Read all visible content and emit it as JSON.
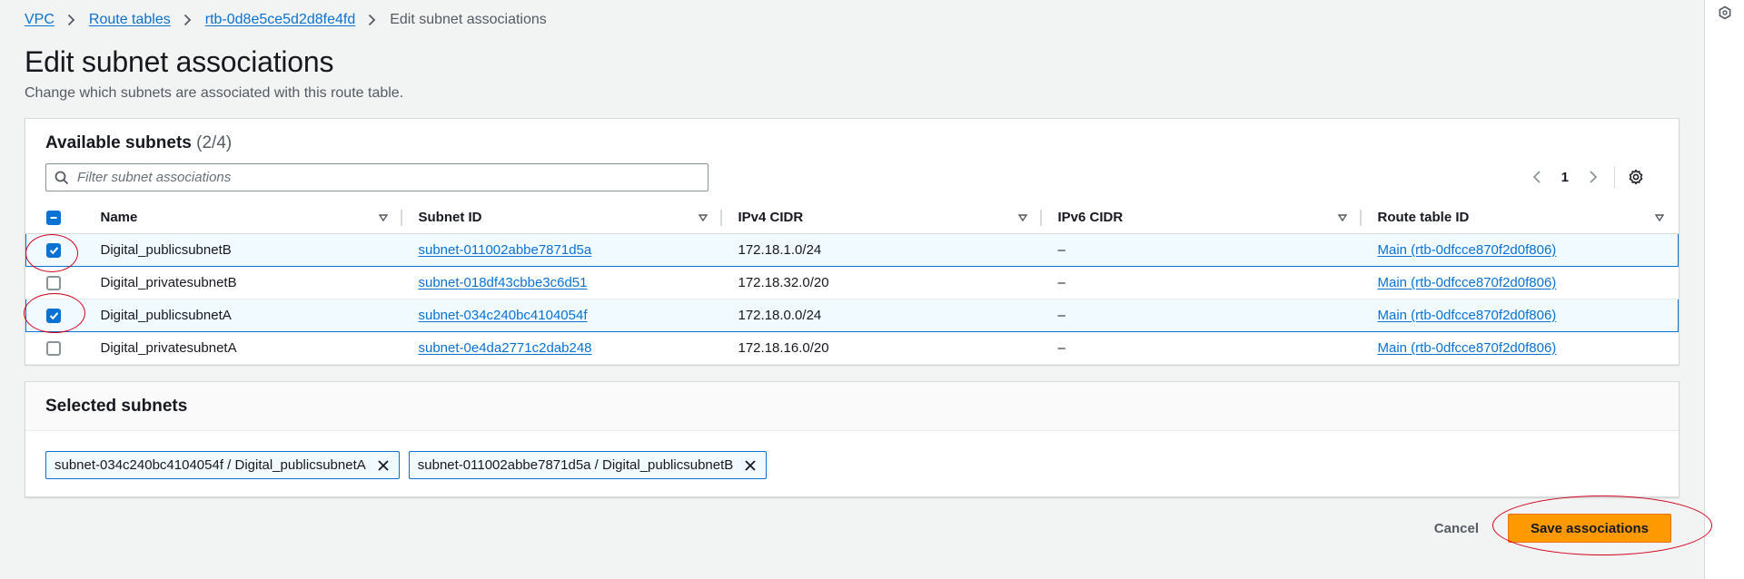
{
  "breadcrumb": {
    "items": [
      "VPC",
      "Route tables",
      "rtb-0d8e5ce5d2d8fe4fd"
    ],
    "current": "Edit subnet associations"
  },
  "page": {
    "title": "Edit subnet associations",
    "description": "Change which subnets are associated with this route table."
  },
  "available": {
    "title": "Available subnets",
    "count": "(2/4)",
    "search_placeholder": "Filter subnet associations",
    "page_number": "1",
    "columns": [
      "Name",
      "Subnet ID",
      "IPv4 CIDR",
      "IPv6 CIDR",
      "Route table ID"
    ],
    "rows": [
      {
        "name": "Digital_publicsubnetB",
        "subnet_id": "subnet-011002abbe7871d5a",
        "ipv4": "172.18.1.0/24",
        "ipv6": "–",
        "route_table": "Main (rtb-0dfcce870f2d0f806)",
        "checked": true
      },
      {
        "name": "Digital_privatesubnetB",
        "subnet_id": "subnet-018df43cbbe3c6d51",
        "ipv4": "172.18.32.0/20",
        "ipv6": "–",
        "route_table": "Main (rtb-0dfcce870f2d0f806)",
        "checked": false
      },
      {
        "name": "Digital_publicsubnetA",
        "subnet_id": "subnet-034c240bc4104054f",
        "ipv4": "172.18.0.0/24",
        "ipv6": "–",
        "route_table": "Main (rtb-0dfcce870f2d0f806)",
        "checked": true
      },
      {
        "name": "Digital_privatesubnetA",
        "subnet_id": "subnet-0e4da2771c2dab248",
        "ipv4": "172.18.16.0/20",
        "ipv6": "–",
        "route_table": "Main (rtb-0dfcce870f2d0f806)",
        "checked": false
      }
    ]
  },
  "selected": {
    "title": "Selected subnets",
    "tokens": [
      "subnet-034c240bc4104054f / Digital_publicsubnetA",
      "subnet-011002abbe7871d5a / Digital_publicsubnetB"
    ]
  },
  "actions": {
    "cancel_label": "Cancel",
    "save_label": "Save associations"
  },
  "colors": {
    "accent": "#0972d3",
    "primary_button": "#ff9900",
    "annotation": "#d0021b"
  },
  "icons": [
    "chevron-right-icon",
    "search-icon",
    "chevron-left-icon",
    "gear-icon",
    "sort-caret-icon",
    "close-icon",
    "hexagon-icon"
  ]
}
